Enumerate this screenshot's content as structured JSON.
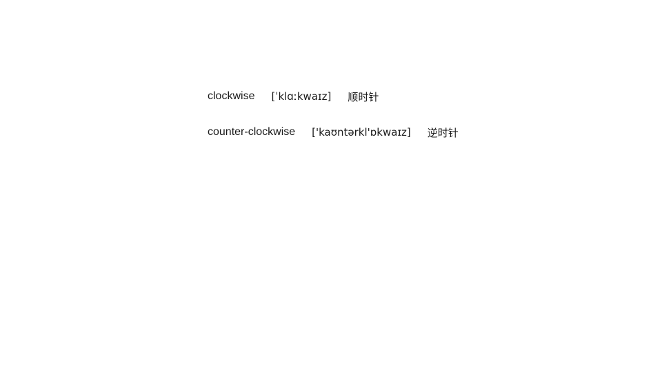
{
  "vocab": [
    {
      "word": "clockwise",
      "phonetic": "[ˈklɑːkwaɪz]",
      "meaning": "顺时针"
    },
    {
      "word": "counter-clockwise",
      "phonetic": "['kaʊntərkl'ɒkwaɪz]",
      "meaning": "逆时针"
    }
  ]
}
